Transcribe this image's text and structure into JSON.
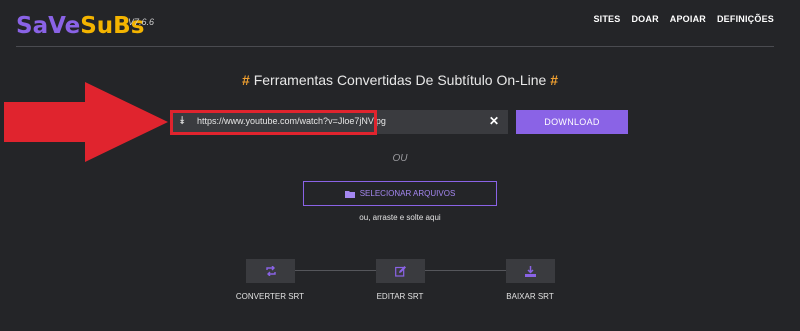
{
  "header": {
    "logo_part1": "SaVe",
    "logo_part2": "SuBs",
    "version": "V7.6.6",
    "nav": [
      {
        "label": "SITES"
      },
      {
        "label": "DOAR"
      },
      {
        "label": "APOIAR"
      },
      {
        "label": "DEFINIÇÕES"
      }
    ]
  },
  "main": {
    "title_hash_left": "#",
    "title": "Ferramentas Convertidas De Subtítulo On-Line",
    "title_hash_right": "#",
    "url_input": {
      "value": "https://www.youtube.com/watch?v=Jloe7jNVlpg",
      "chevron_icon": "double-chevron-down-icon",
      "clear_icon": "close-icon"
    },
    "download_label": "DOWNLOAD",
    "or_label": "OU",
    "select_files_label": "SELECIONAR ARQUIVOS",
    "select_files_icon": "folder-icon",
    "drop_hint": "ou, arraste e solte aqui"
  },
  "steps": [
    {
      "label": "CONVERTER SRT",
      "icon": "repeat-icon"
    },
    {
      "label": "EDITAR SRT",
      "icon": "edit-icon"
    },
    {
      "label": "BAIXAR SRT",
      "icon": "download-icon"
    }
  ],
  "colors": {
    "background": "#242528",
    "accent": "#8a63e6",
    "logo_yellow": "#f4b400",
    "hash": "#f0a030",
    "annotation_red": "#e0242e"
  }
}
